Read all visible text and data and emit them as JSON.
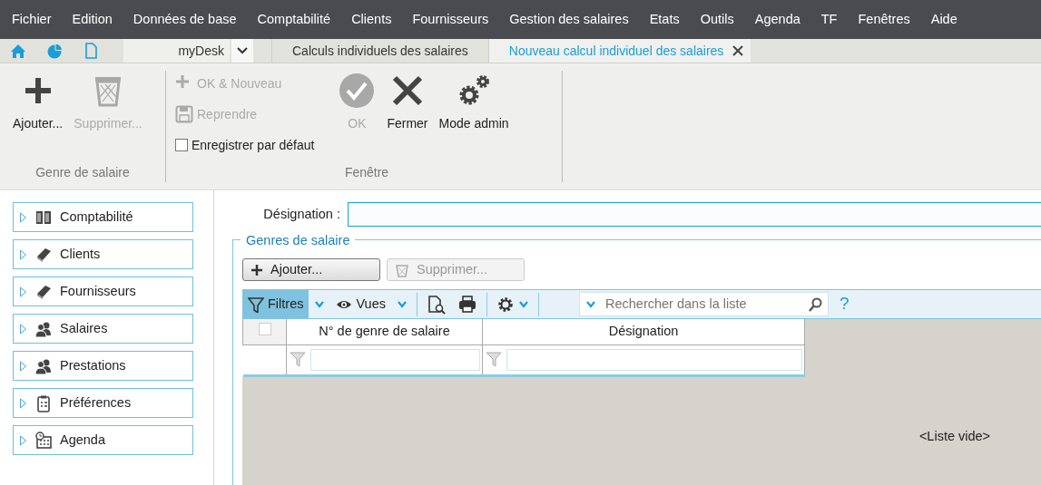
{
  "menu": [
    "Fichier",
    "Edition",
    "Données de base",
    "Comptabilité",
    "Clients",
    "Fournisseurs",
    "Gestion des salaires",
    "Etats",
    "Outils",
    "Agenda",
    "TF",
    "Fenêtres",
    "Aide"
  ],
  "desk": {
    "label": "myDesk"
  },
  "tabs": [
    {
      "label": "Calculs individuels des salaires",
      "selected": false,
      "closable": false
    },
    {
      "label": "Nouveau calcul individuel des salaires",
      "selected": true,
      "closable": true
    }
  ],
  "ribbon": [
    {
      "title": "Genre de salaire",
      "items": [
        {
          "kind": "large",
          "label": "Ajouter...",
          "disabled": false
        },
        {
          "kind": "large",
          "label": "Supprimer...",
          "disabled": true
        }
      ]
    },
    {
      "title": "Fenêtre",
      "items": [
        {
          "kind": "small",
          "label": "OK & Nouveau",
          "disabled": true
        },
        {
          "kind": "small",
          "label": "Reprendre",
          "disabled": true
        },
        {
          "kind": "checkbox",
          "label": "Enregistrer par défaut",
          "checked": false
        },
        {
          "kind": "large",
          "label": "OK",
          "disabled": true
        },
        {
          "kind": "large",
          "label": "Fermer",
          "disabled": false
        },
        {
          "kind": "large",
          "label": "Mode admin",
          "disabled": false
        }
      ]
    }
  ],
  "sidebar": {
    "items": [
      {
        "label": "Comptabilité",
        "expanded": false
      },
      {
        "label": "Clients",
        "expanded": false
      },
      {
        "label": "Fournisseurs",
        "expanded": false
      },
      {
        "label": "Salaires",
        "expanded": false
      },
      {
        "label": "Prestations",
        "expanded": false
      },
      {
        "label": "Préférences",
        "expanded": false
      },
      {
        "label": "Agenda",
        "expanded": false
      }
    ]
  },
  "form": {
    "designation_label": "Désignation :",
    "group_title": "Genres de salaire",
    "buttons": [
      {
        "label": "Ajouter...",
        "disabled": false
      },
      {
        "label": "Supprimer...",
        "disabled": true
      }
    ],
    "toolbar": {
      "items": [
        {
          "label": "Filtres",
          "selected": true
        },
        {
          "label": "Vues",
          "selected": false
        }
      ],
      "search_placeholder": "Rechercher dans la liste",
      "help": "?"
    },
    "table": {
      "select_all_checked": false,
      "columns": [
        "N° de genre de salaire",
        "Désignation"
      ],
      "empty_text": "<Liste vide>"
    }
  }
}
